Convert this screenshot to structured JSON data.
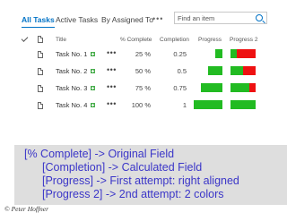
{
  "tabs": [
    {
      "label": "All Tasks",
      "active": true
    },
    {
      "label": "Active Tasks",
      "active": false
    },
    {
      "label": "By Assigned To",
      "active": false
    }
  ],
  "more_label": "•••",
  "search": {
    "placeholder": "Find an item"
  },
  "columns": {
    "title": "Title",
    "percent_complete": "% Complete",
    "completion": "Completion",
    "progress": "Progress",
    "progress_2": "Progress 2"
  },
  "tasks": [
    {
      "title": "Task No. 1",
      "percent": "25 %",
      "completion": "0.25",
      "progress": 0.25,
      "more": "•••"
    },
    {
      "title": "Task No. 2",
      "percent": "50 %",
      "completion": "0.5",
      "progress": 0.5,
      "more": "•••"
    },
    {
      "title": "Task No. 3",
      "percent": "75 %",
      "completion": "0.75",
      "progress": 0.75,
      "more": "•••"
    },
    {
      "title": "Task No. 4",
      "percent": "100 %",
      "completion": "1",
      "progress": 1.0,
      "more": "•••"
    }
  ],
  "colors": {
    "accent": "#0072c6",
    "bar_green": "#22bb22",
    "bar_red": "#ee1111",
    "note_text": "#3b36c8"
  },
  "annotation": {
    "line1": "[% Complete] -> Original Field",
    "line2": "[Completion]  -> Calculated Field",
    "line3": "[Progress]     -> First attempt: right aligned",
    "line4": "[Progress 2]   -> 2nd attempt: 2 colors"
  },
  "credit": "© Peter Hoffner"
}
